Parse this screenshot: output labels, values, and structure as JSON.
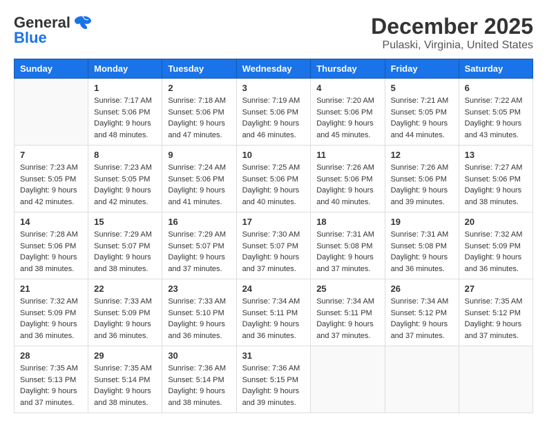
{
  "logo": {
    "line1": "General",
    "line2": "Blue"
  },
  "title": "December 2025",
  "subtitle": "Pulaski, Virginia, United States",
  "days_of_week": [
    "Sunday",
    "Monday",
    "Tuesday",
    "Wednesday",
    "Thursday",
    "Friday",
    "Saturday"
  ],
  "weeks": [
    [
      {
        "day": "",
        "sunrise": "",
        "sunset": "",
        "daylight": ""
      },
      {
        "day": "1",
        "sunrise": "Sunrise: 7:17 AM",
        "sunset": "Sunset: 5:06 PM",
        "daylight": "Daylight: 9 hours and 48 minutes."
      },
      {
        "day": "2",
        "sunrise": "Sunrise: 7:18 AM",
        "sunset": "Sunset: 5:06 PM",
        "daylight": "Daylight: 9 hours and 47 minutes."
      },
      {
        "day": "3",
        "sunrise": "Sunrise: 7:19 AM",
        "sunset": "Sunset: 5:06 PM",
        "daylight": "Daylight: 9 hours and 46 minutes."
      },
      {
        "day": "4",
        "sunrise": "Sunrise: 7:20 AM",
        "sunset": "Sunset: 5:06 PM",
        "daylight": "Daylight: 9 hours and 45 minutes."
      },
      {
        "day": "5",
        "sunrise": "Sunrise: 7:21 AM",
        "sunset": "Sunset: 5:05 PM",
        "daylight": "Daylight: 9 hours and 44 minutes."
      },
      {
        "day": "6",
        "sunrise": "Sunrise: 7:22 AM",
        "sunset": "Sunset: 5:05 PM",
        "daylight": "Daylight: 9 hours and 43 minutes."
      }
    ],
    [
      {
        "day": "7",
        "sunrise": "Sunrise: 7:23 AM",
        "sunset": "Sunset: 5:05 PM",
        "daylight": "Daylight: 9 hours and 42 minutes."
      },
      {
        "day": "8",
        "sunrise": "Sunrise: 7:23 AM",
        "sunset": "Sunset: 5:05 PM",
        "daylight": "Daylight: 9 hours and 42 minutes."
      },
      {
        "day": "9",
        "sunrise": "Sunrise: 7:24 AM",
        "sunset": "Sunset: 5:06 PM",
        "daylight": "Daylight: 9 hours and 41 minutes."
      },
      {
        "day": "10",
        "sunrise": "Sunrise: 7:25 AM",
        "sunset": "Sunset: 5:06 PM",
        "daylight": "Daylight: 9 hours and 40 minutes."
      },
      {
        "day": "11",
        "sunrise": "Sunrise: 7:26 AM",
        "sunset": "Sunset: 5:06 PM",
        "daylight": "Daylight: 9 hours and 40 minutes."
      },
      {
        "day": "12",
        "sunrise": "Sunrise: 7:26 AM",
        "sunset": "Sunset: 5:06 PM",
        "daylight": "Daylight: 9 hours and 39 minutes."
      },
      {
        "day": "13",
        "sunrise": "Sunrise: 7:27 AM",
        "sunset": "Sunset: 5:06 PM",
        "daylight": "Daylight: 9 hours and 38 minutes."
      }
    ],
    [
      {
        "day": "14",
        "sunrise": "Sunrise: 7:28 AM",
        "sunset": "Sunset: 5:06 PM",
        "daylight": "Daylight: 9 hours and 38 minutes."
      },
      {
        "day": "15",
        "sunrise": "Sunrise: 7:29 AM",
        "sunset": "Sunset: 5:07 PM",
        "daylight": "Daylight: 9 hours and 38 minutes."
      },
      {
        "day": "16",
        "sunrise": "Sunrise: 7:29 AM",
        "sunset": "Sunset: 5:07 PM",
        "daylight": "Daylight: 9 hours and 37 minutes."
      },
      {
        "day": "17",
        "sunrise": "Sunrise: 7:30 AM",
        "sunset": "Sunset: 5:07 PM",
        "daylight": "Daylight: 9 hours and 37 minutes."
      },
      {
        "day": "18",
        "sunrise": "Sunrise: 7:31 AM",
        "sunset": "Sunset: 5:08 PM",
        "daylight": "Daylight: 9 hours and 37 minutes."
      },
      {
        "day": "19",
        "sunrise": "Sunrise: 7:31 AM",
        "sunset": "Sunset: 5:08 PM",
        "daylight": "Daylight: 9 hours and 36 minutes."
      },
      {
        "day": "20",
        "sunrise": "Sunrise: 7:32 AM",
        "sunset": "Sunset: 5:09 PM",
        "daylight": "Daylight: 9 hours and 36 minutes."
      }
    ],
    [
      {
        "day": "21",
        "sunrise": "Sunrise: 7:32 AM",
        "sunset": "Sunset: 5:09 PM",
        "daylight": "Daylight: 9 hours and 36 minutes."
      },
      {
        "day": "22",
        "sunrise": "Sunrise: 7:33 AM",
        "sunset": "Sunset: 5:09 PM",
        "daylight": "Daylight: 9 hours and 36 minutes."
      },
      {
        "day": "23",
        "sunrise": "Sunrise: 7:33 AM",
        "sunset": "Sunset: 5:10 PM",
        "daylight": "Daylight: 9 hours and 36 minutes."
      },
      {
        "day": "24",
        "sunrise": "Sunrise: 7:34 AM",
        "sunset": "Sunset: 5:11 PM",
        "daylight": "Daylight: 9 hours and 36 minutes."
      },
      {
        "day": "25",
        "sunrise": "Sunrise: 7:34 AM",
        "sunset": "Sunset: 5:11 PM",
        "daylight": "Daylight: 9 hours and 37 minutes."
      },
      {
        "day": "26",
        "sunrise": "Sunrise: 7:34 AM",
        "sunset": "Sunset: 5:12 PM",
        "daylight": "Daylight: 9 hours and 37 minutes."
      },
      {
        "day": "27",
        "sunrise": "Sunrise: 7:35 AM",
        "sunset": "Sunset: 5:12 PM",
        "daylight": "Daylight: 9 hours and 37 minutes."
      }
    ],
    [
      {
        "day": "28",
        "sunrise": "Sunrise: 7:35 AM",
        "sunset": "Sunset: 5:13 PM",
        "daylight": "Daylight: 9 hours and 37 minutes."
      },
      {
        "day": "29",
        "sunrise": "Sunrise: 7:35 AM",
        "sunset": "Sunset: 5:14 PM",
        "daylight": "Daylight: 9 hours and 38 minutes."
      },
      {
        "day": "30",
        "sunrise": "Sunrise: 7:36 AM",
        "sunset": "Sunset: 5:14 PM",
        "daylight": "Daylight: 9 hours and 38 minutes."
      },
      {
        "day": "31",
        "sunrise": "Sunrise: 7:36 AM",
        "sunset": "Sunset: 5:15 PM",
        "daylight": "Daylight: 9 hours and 39 minutes."
      },
      {
        "day": "",
        "sunrise": "",
        "sunset": "",
        "daylight": ""
      },
      {
        "day": "",
        "sunrise": "",
        "sunset": "",
        "daylight": ""
      },
      {
        "day": "",
        "sunrise": "",
        "sunset": "",
        "daylight": ""
      }
    ]
  ]
}
